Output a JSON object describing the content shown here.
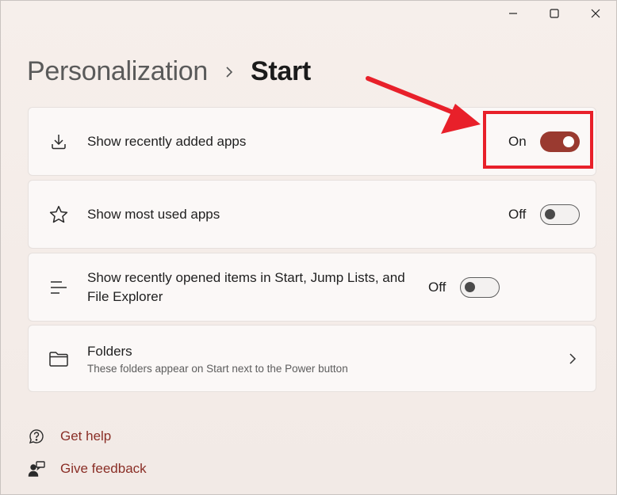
{
  "window": {
    "controls": {
      "minimize": "minimize-icon",
      "maximize": "maximize-icon",
      "close": "close-icon"
    }
  },
  "breadcrumb": {
    "parent": "Personalization",
    "current": "Start"
  },
  "settings": [
    {
      "title": "Show recently added apps",
      "state": "On",
      "icon": "download-icon"
    },
    {
      "title": "Show most used apps",
      "state": "Off",
      "icon": "star-icon"
    },
    {
      "title": "Show recently opened items in Start, Jump Lists, and File Explorer",
      "state": "Off",
      "icon": "list-icon"
    },
    {
      "title": "Folders",
      "subtitle": "These folders appear on Start next to the Power button",
      "icon": "folder-icon"
    }
  ],
  "footer": {
    "help": "Get help",
    "feedback": "Give feedback"
  },
  "colors": {
    "accent": "#9a3a30",
    "annotation": "#e8202a",
    "link": "#8a2e26"
  }
}
